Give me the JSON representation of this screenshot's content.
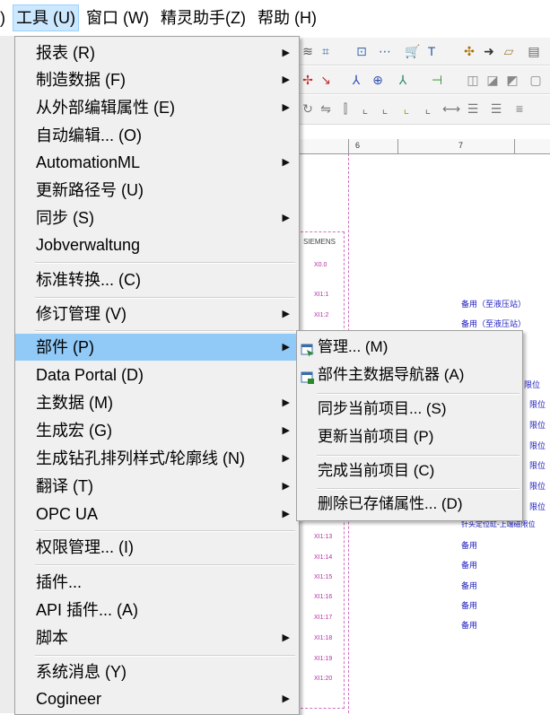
{
  "menubar": {
    "items": [
      ")",
      "工具 (U)",
      "窗口 (W)",
      "精灵助手(Z)",
      "帮助 (H)"
    ],
    "active_index": 1
  },
  "tools_menu": {
    "items": [
      {
        "label": "报表 (R)",
        "submenu": true
      },
      {
        "label": "制造数据 (F)",
        "submenu": true
      },
      {
        "label": "从外部编辑属性 (E)",
        "submenu": true
      },
      {
        "label": "自动编辑... (O)",
        "submenu": false
      },
      {
        "label": "AutomationML",
        "submenu": true
      },
      {
        "label": "更新路径号 (U)",
        "submenu": false
      },
      {
        "label": "同步 (S)",
        "submenu": true
      },
      {
        "label": "Jobverwaltung",
        "submenu": false
      },
      {
        "label": "标准转换... (C)",
        "submenu": false
      },
      {
        "label": "修订管理 (V)",
        "submenu": true
      },
      {
        "label": "部件 (P)",
        "submenu": true
      },
      {
        "label": "Data Portal (D)",
        "submenu": false
      },
      {
        "label": "主数据 (M)",
        "submenu": true
      },
      {
        "label": "生成宏 (G)",
        "submenu": true
      },
      {
        "label": "生成钻孔排列样式/轮廓线 (N)",
        "submenu": true
      },
      {
        "label": "翻译 (T)",
        "submenu": true
      },
      {
        "label": "OPC UA",
        "submenu": true
      },
      {
        "label": "权限管理... (I)",
        "submenu": false
      },
      {
        "label": "插件...",
        "submenu": false
      },
      {
        "label": "API 插件... (A)",
        "submenu": false
      },
      {
        "label": "脚本",
        "submenu": true
      },
      {
        "label": "系统消息 (Y)",
        "submenu": false
      },
      {
        "label": "Cogineer",
        "submenu": true
      }
    ],
    "highlighted": "部件 (P)"
  },
  "parts_submenu": {
    "items": [
      {
        "label": "管理... (M)",
        "icon": "parts-management-icon"
      },
      {
        "label": "部件主数据导航器 (A)",
        "icon": "parts-navigator-icon"
      },
      {
        "label": "同步当前项目... (S)",
        "icon": ""
      },
      {
        "label": "更新当前项目 (P)",
        "icon": ""
      },
      {
        "label": "完成当前项目 (C)",
        "icon": ""
      },
      {
        "label": "删除已存储属性... (D)",
        "icon": ""
      }
    ]
  },
  "canvas": {
    "ruler_numbers": [
      "6",
      "7"
    ],
    "plc_header": "SIEMENS",
    "plc_pins": [
      "X0.0",
      "XI1:1",
      "XI1:2",
      "XI1:13",
      "XI1:14",
      "XI1:15",
      "XI1:16",
      "XI1:17",
      "XI1:18",
      "XI1:19",
      "XI1:20"
    ],
    "right_labels": [
      "备用（至液压站）",
      "备用（至液压站）",
      "限位",
      "限位",
      "限位",
      "限位",
      "限位",
      "限位",
      "限位",
      "针头定位缸-上端磁限位",
      "备用",
      "备用",
      "备用",
      "备用",
      "备用"
    ]
  },
  "colors": {
    "menu_bg": "#f0f0f0",
    "highlight": "#91c9f7",
    "menubar_active": "#cce8ff",
    "dashed_frame": "#d070c0",
    "canvas_text": "#2020c0"
  }
}
